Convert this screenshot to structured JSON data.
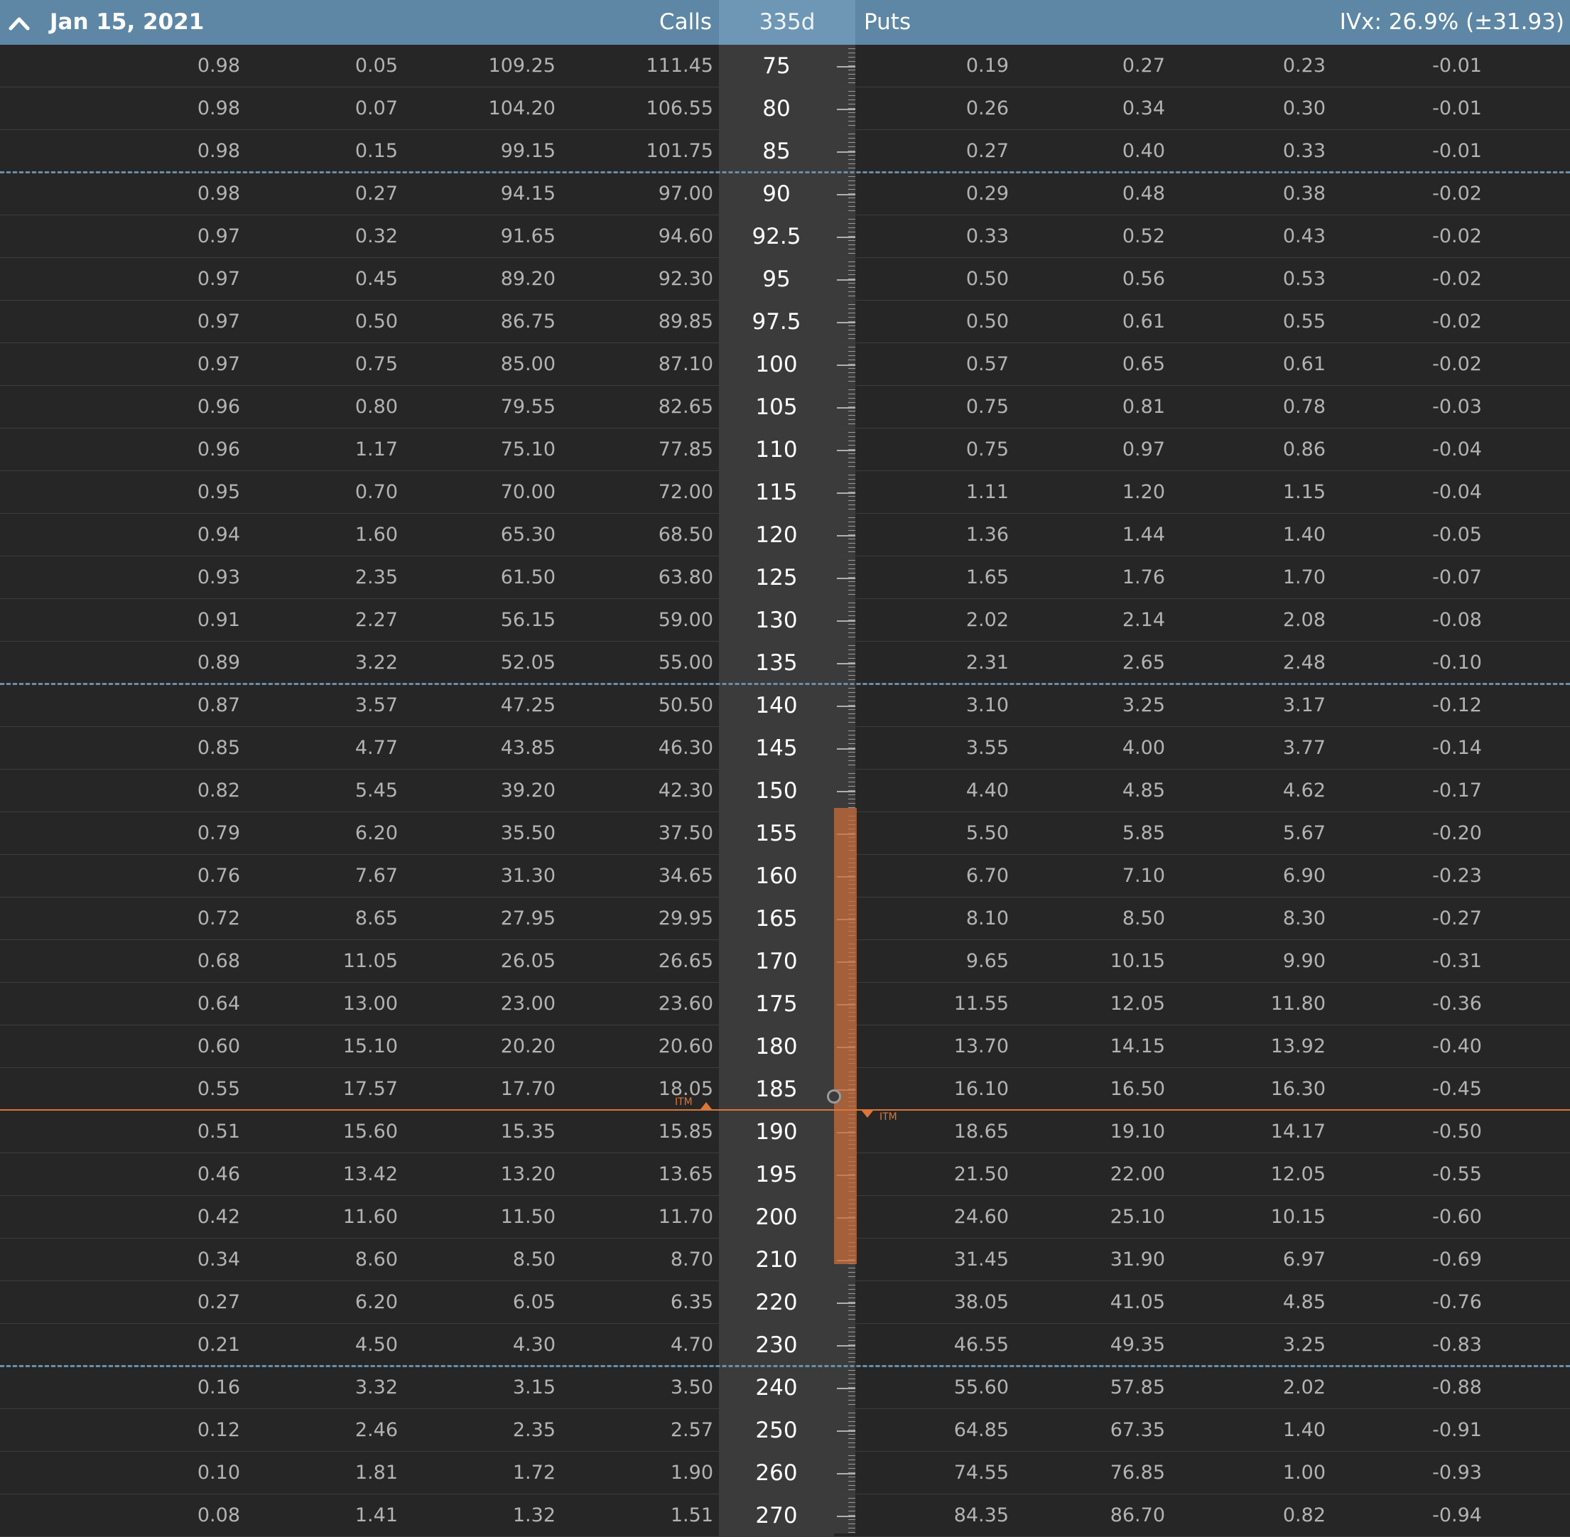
{
  "header": {
    "expiration": "Jan 15, 2021",
    "calls_label": "Calls",
    "days_to_expiry": "335d",
    "puts_label": "Puts",
    "ivx": "IVx: 26.9% (±31.93)"
  },
  "itm_label": "ITM",
  "colors": {
    "header": "#5e87a5",
    "accent": "#d9763a",
    "dash": "#6a8ea8"
  },
  "rows": [
    {
      "strike": "75",
      "calls": [
        "0.98",
        "0.05",
        "109.25",
        "111.45"
      ],
      "puts": [
        "0.19",
        "0.27",
        "0.23",
        "-0.01"
      ]
    },
    {
      "strike": "80",
      "calls": [
        "0.98",
        "0.07",
        "104.20",
        "106.55"
      ],
      "puts": [
        "0.26",
        "0.34",
        "0.30",
        "-0.01"
      ]
    },
    {
      "strike": "85",
      "calls": [
        "0.98",
        "0.15",
        "99.15",
        "101.75"
      ],
      "puts": [
        "0.27",
        "0.40",
        "0.33",
        "-0.01"
      ]
    },
    {
      "strike": "90",
      "calls": [
        "0.98",
        "0.27",
        "94.15",
        "97.00"
      ],
      "puts": [
        "0.29",
        "0.48",
        "0.38",
        "-0.02"
      ]
    },
    {
      "strike": "92.5",
      "calls": [
        "0.97",
        "0.32",
        "91.65",
        "94.60"
      ],
      "puts": [
        "0.33",
        "0.52",
        "0.43",
        "-0.02"
      ]
    },
    {
      "strike": "95",
      "calls": [
        "0.97",
        "0.45",
        "89.20",
        "92.30"
      ],
      "puts": [
        "0.50",
        "0.56",
        "0.53",
        "-0.02"
      ]
    },
    {
      "strike": "97.5",
      "calls": [
        "0.97",
        "0.50",
        "86.75",
        "89.85"
      ],
      "puts": [
        "0.50",
        "0.61",
        "0.55",
        "-0.02"
      ]
    },
    {
      "strike": "100",
      "calls": [
        "0.97",
        "0.75",
        "85.00",
        "87.10"
      ],
      "puts": [
        "0.57",
        "0.65",
        "0.61",
        "-0.02"
      ]
    },
    {
      "strike": "105",
      "calls": [
        "0.96",
        "0.80",
        "79.55",
        "82.65"
      ],
      "puts": [
        "0.75",
        "0.81",
        "0.78",
        "-0.03"
      ]
    },
    {
      "strike": "110",
      "calls": [
        "0.96",
        "1.17",
        "75.10",
        "77.85"
      ],
      "puts": [
        "0.75",
        "0.97",
        "0.86",
        "-0.04"
      ]
    },
    {
      "strike": "115",
      "calls": [
        "0.95",
        "0.70",
        "70.00",
        "72.00"
      ],
      "puts": [
        "1.11",
        "1.20",
        "1.15",
        "-0.04"
      ]
    },
    {
      "strike": "120",
      "calls": [
        "0.94",
        "1.60",
        "65.30",
        "68.50"
      ],
      "puts": [
        "1.36",
        "1.44",
        "1.40",
        "-0.05"
      ]
    },
    {
      "strike": "125",
      "calls": [
        "0.93",
        "2.35",
        "61.50",
        "63.80"
      ],
      "puts": [
        "1.65",
        "1.76",
        "1.70",
        "-0.07"
      ]
    },
    {
      "strike": "130",
      "calls": [
        "0.91",
        "2.27",
        "56.15",
        "59.00"
      ],
      "puts": [
        "2.02",
        "2.14",
        "2.08",
        "-0.08"
      ]
    },
    {
      "strike": "135",
      "calls": [
        "0.89",
        "3.22",
        "52.05",
        "55.00"
      ],
      "puts": [
        "2.31",
        "2.65",
        "2.48",
        "-0.10"
      ]
    },
    {
      "strike": "140",
      "calls": [
        "0.87",
        "3.57",
        "47.25",
        "50.50"
      ],
      "puts": [
        "3.10",
        "3.25",
        "3.17",
        "-0.12"
      ]
    },
    {
      "strike": "145",
      "calls": [
        "0.85",
        "4.77",
        "43.85",
        "46.30"
      ],
      "puts": [
        "3.55",
        "4.00",
        "3.77",
        "-0.14"
      ]
    },
    {
      "strike": "150",
      "calls": [
        "0.82",
        "5.45",
        "39.20",
        "42.30"
      ],
      "puts": [
        "4.40",
        "4.85",
        "4.62",
        "-0.17"
      ]
    },
    {
      "strike": "155",
      "calls": [
        "0.79",
        "6.20",
        "35.50",
        "37.50"
      ],
      "puts": [
        "5.50",
        "5.85",
        "5.67",
        "-0.20"
      ]
    },
    {
      "strike": "160",
      "calls": [
        "0.76",
        "7.67",
        "31.30",
        "34.65"
      ],
      "puts": [
        "6.70",
        "7.10",
        "6.90",
        "-0.23"
      ]
    },
    {
      "strike": "165",
      "calls": [
        "0.72",
        "8.65",
        "27.95",
        "29.95"
      ],
      "puts": [
        "8.10",
        "8.50",
        "8.30",
        "-0.27"
      ]
    },
    {
      "strike": "170",
      "calls": [
        "0.68",
        "11.05",
        "26.05",
        "26.65"
      ],
      "puts": [
        "9.65",
        "10.15",
        "9.90",
        "-0.31"
      ]
    },
    {
      "strike": "175",
      "calls": [
        "0.64",
        "13.00",
        "23.00",
        "23.60"
      ],
      "puts": [
        "11.55",
        "12.05",
        "11.80",
        "-0.36"
      ]
    },
    {
      "strike": "180",
      "calls": [
        "0.60",
        "15.10",
        "20.20",
        "20.60"
      ],
      "puts": [
        "13.70",
        "14.15",
        "13.92",
        "-0.40"
      ]
    },
    {
      "strike": "185",
      "calls": [
        "0.55",
        "17.57",
        "17.70",
        "18.05"
      ],
      "puts": [
        "16.10",
        "16.50",
        "16.30",
        "-0.45"
      ]
    },
    {
      "strike": "190",
      "calls": [
        "0.51",
        "15.60",
        "15.35",
        "15.85"
      ],
      "puts": [
        "18.65",
        "19.10",
        "14.17",
        "-0.50"
      ]
    },
    {
      "strike": "195",
      "calls": [
        "0.46",
        "13.42",
        "13.20",
        "13.65"
      ],
      "puts": [
        "21.50",
        "22.00",
        "12.05",
        "-0.55"
      ]
    },
    {
      "strike": "200",
      "calls": [
        "0.42",
        "11.60",
        "11.50",
        "11.70"
      ],
      "puts": [
        "24.60",
        "25.10",
        "10.15",
        "-0.60"
      ]
    },
    {
      "strike": "210",
      "calls": [
        "0.34",
        "8.60",
        "8.50",
        "8.70"
      ],
      "puts": [
        "31.45",
        "31.90",
        "6.97",
        "-0.69"
      ]
    },
    {
      "strike": "220",
      "calls": [
        "0.27",
        "6.20",
        "6.05",
        "6.35"
      ],
      "puts": [
        "38.05",
        "41.05",
        "4.85",
        "-0.76"
      ]
    },
    {
      "strike": "230",
      "calls": [
        "0.21",
        "4.50",
        "4.30",
        "4.70"
      ],
      "puts": [
        "46.55",
        "49.35",
        "3.25",
        "-0.83"
      ]
    },
    {
      "strike": "240",
      "calls": [
        "0.16",
        "3.32",
        "3.15",
        "3.50"
      ],
      "puts": [
        "55.60",
        "57.85",
        "2.02",
        "-0.88"
      ]
    },
    {
      "strike": "250",
      "calls": [
        "0.12",
        "2.46",
        "2.35",
        "2.57"
      ],
      "puts": [
        "64.85",
        "67.35",
        "1.40",
        "-0.91"
      ]
    },
    {
      "strike": "260",
      "calls": [
        "0.10",
        "1.81",
        "1.72",
        "1.90"
      ],
      "puts": [
        "74.55",
        "76.85",
        "1.00",
        "-0.93"
      ]
    },
    {
      "strike": "270",
      "calls": [
        "0.08",
        "1.41",
        "1.32",
        "1.51"
      ],
      "puts": [
        "84.35",
        "86.70",
        "0.82",
        "-0.94"
      ]
    }
  ]
}
